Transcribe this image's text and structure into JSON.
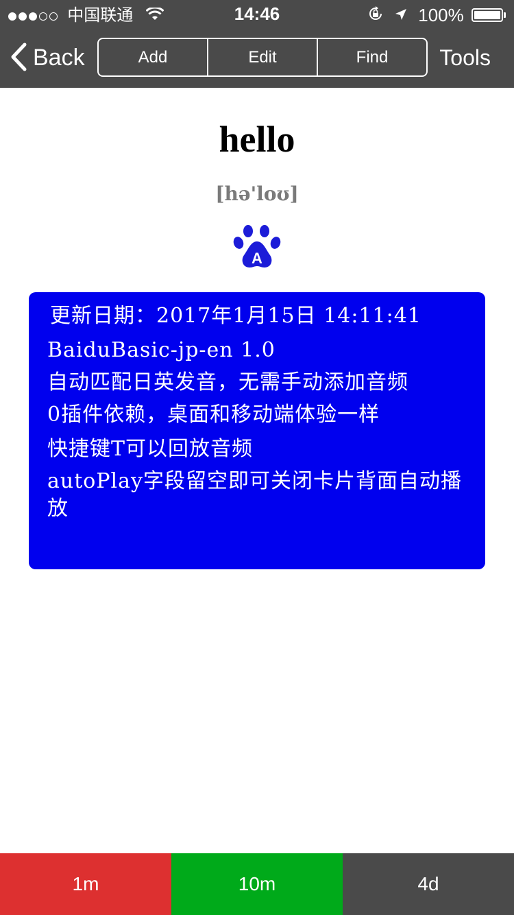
{
  "status_bar": {
    "carrier": "中国联通",
    "time": "14:46",
    "battery_percent": "100%",
    "battery_level": 1.0,
    "signal_filled": 3,
    "signal_total": 5
  },
  "nav": {
    "back_label": "Back",
    "segments": [
      "Add",
      "Edit",
      "Find"
    ],
    "tools_label": "Tools"
  },
  "card": {
    "word": "hello",
    "phonetic": "[hə'loʊ]",
    "audio_icon": "baidu-paw-icon",
    "info_lines": [
      "更新日期：2017年1月15日 14:11:41",
      "BaiduBasic-jp-en 1.0",
      "自动匹配日英发音，无需手动添加音频",
      "0插件依赖，桌面和移动端体验一样",
      "快捷键T可以回放音频",
      "autoPlay字段留空即可关闭卡片背面自动播放"
    ]
  },
  "answer_buttons": [
    {
      "label": "1m",
      "color": "#dd3030"
    },
    {
      "label": "10m",
      "color": "#00aa1a"
    },
    {
      "label": "4d",
      "color": "#4a4a4a"
    }
  ],
  "colors": {
    "bar_bg": "#4a4a4a",
    "info_bg": "#0000ee",
    "phonetic": "#7a7a7a",
    "paw": "#1c1cd8"
  }
}
